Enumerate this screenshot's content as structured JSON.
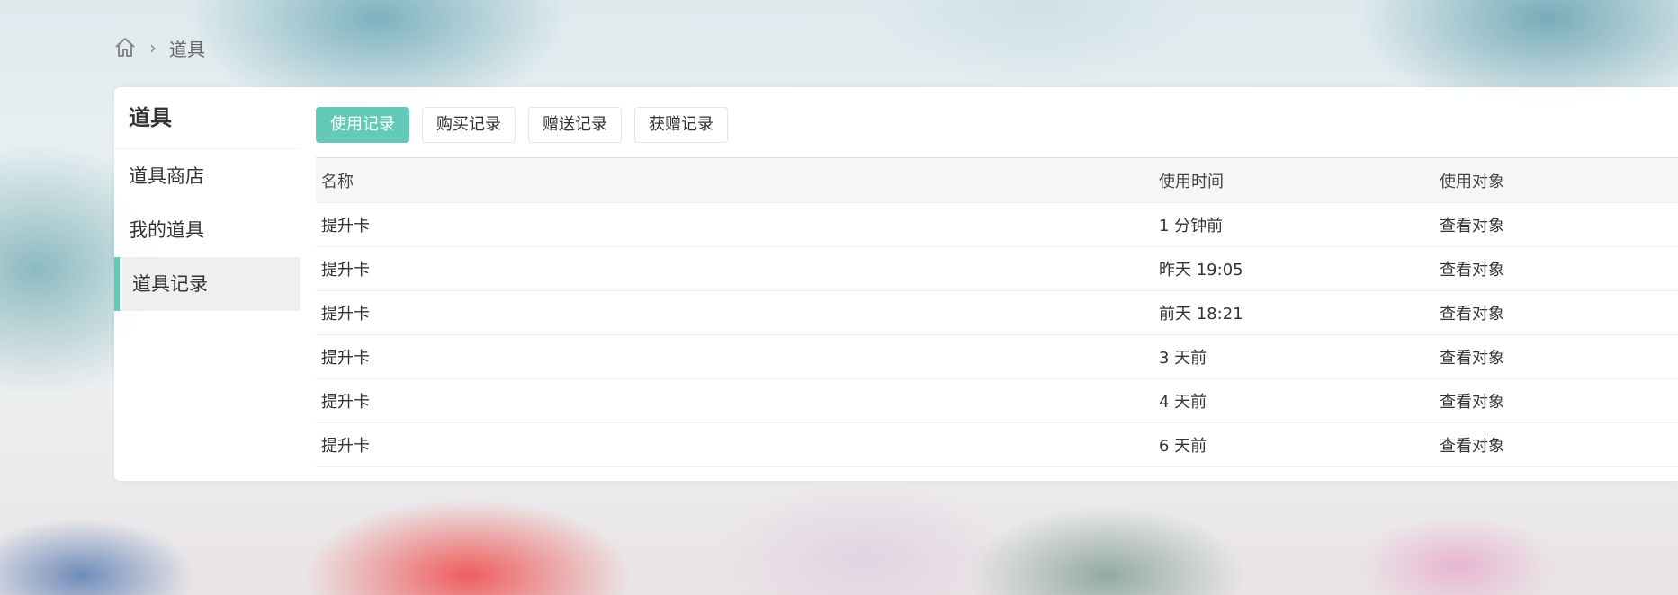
{
  "breadcrumb": {
    "home_icon": "home-icon",
    "separator": "›",
    "current": "道具"
  },
  "sidebar": {
    "title": "道具",
    "items": [
      {
        "label": "道具商店",
        "active": false
      },
      {
        "label": "我的道具",
        "active": false
      },
      {
        "label": "道具记录",
        "active": true
      }
    ]
  },
  "tabs": [
    {
      "label": "使用记录",
      "active": true
    },
    {
      "label": "购买记录",
      "active": false
    },
    {
      "label": "赠送记录",
      "active": false
    },
    {
      "label": "获赠记录",
      "active": false
    }
  ],
  "table": {
    "headers": [
      "名称",
      "使用时间",
      "使用对象"
    ],
    "rows": [
      {
        "name": "提升卡",
        "time": "1 分钟前",
        "target": "查看对象"
      },
      {
        "name": "提升卡",
        "time": "昨天 19:05",
        "target": "查看对象"
      },
      {
        "name": "提升卡",
        "time": "前天 18:21",
        "target": "查看对象"
      },
      {
        "name": "提升卡",
        "time": "3 天前",
        "target": "查看对象"
      },
      {
        "name": "提升卡",
        "time": "4 天前",
        "target": "查看对象"
      },
      {
        "name": "提升卡",
        "time": "6 天前",
        "target": "查看对象"
      }
    ]
  },
  "colors": {
    "accent": "#62cab6"
  }
}
